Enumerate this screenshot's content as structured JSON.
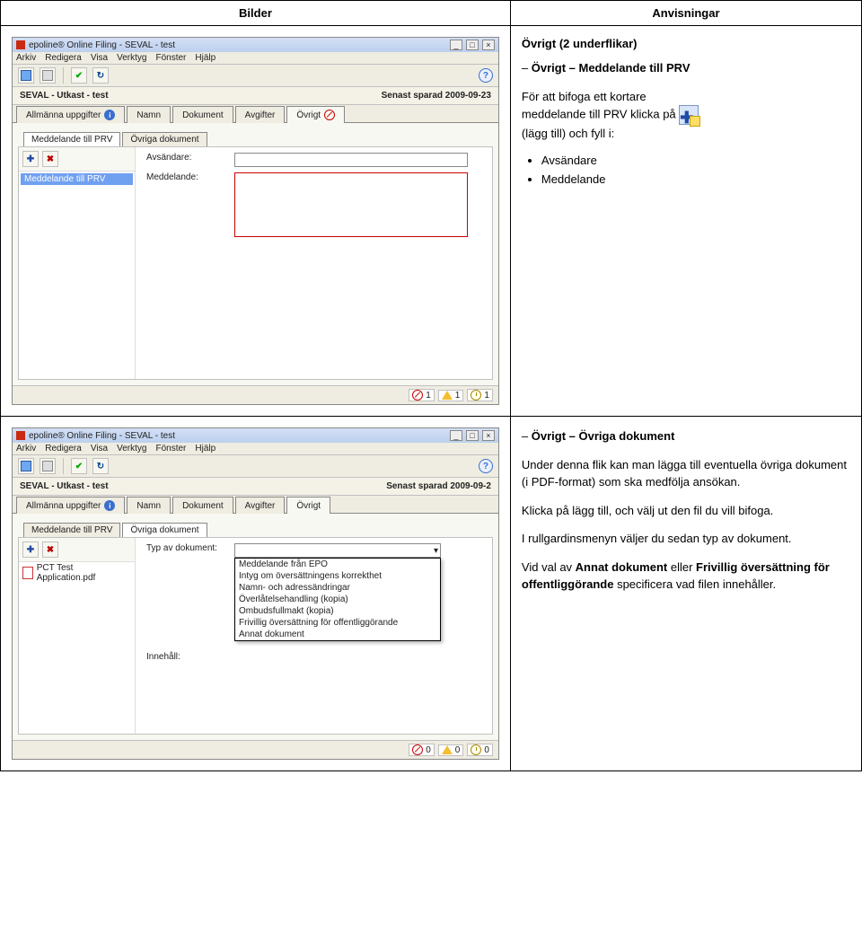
{
  "columns": {
    "left": "Bilder",
    "right": "Anvisningar"
  },
  "shared": {
    "app_title": "epoline® Online Filing - SEVAL - test",
    "menus": [
      "Arkiv",
      "Redigera",
      "Visa",
      "Verktyg",
      "Fönster",
      "Hjälp"
    ],
    "doc_title": "SEVAL - Utkast - test",
    "saved_label": "Senast sparad 2009-09-23",
    "tabs": {
      "allmanna": "Allmänna uppgifter",
      "namn": "Namn",
      "dokument": "Dokument",
      "avgifter": "Avgifter",
      "ovrigt": "Övrigt"
    },
    "status_counts": {
      "stop": "1",
      "warn": "1",
      "info": "1",
      "stop2": "0",
      "warn2": "0",
      "info2": "0"
    }
  },
  "win_top": {
    "subtabs": {
      "tab1": "Meddelande till PRV",
      "tab2": "Övriga dokument"
    },
    "left_item": "Meddelande till PRV",
    "form": {
      "avsandare": "Avsändare:",
      "meddelande": "Meddelande:"
    }
  },
  "win_bot": {
    "saved_label": "Senast sparad 2009-09-2",
    "subtabs": {
      "tab1": "Meddelande till PRV",
      "tab2": "Övriga dokument"
    },
    "file_item": "PCT Test Application.pdf",
    "form": {
      "typ": "Typ av dokument:",
      "innehall": "Innehåll:",
      "options": [
        "Meddelande från EPO",
        "Intyg om översättningens korrekthet",
        "Namn- och adressändringar",
        "Överlåtelsehandling (kopia)",
        "Ombudsfullmakt (kopia)",
        "Frivillig översättning för offentliggörande",
        "Annat dokument"
      ]
    }
  },
  "instr_top": {
    "heading": "Övrigt (2 underflikar)",
    "subtitle": "Övrigt – Meddelande till PRV",
    "p1a": "För att bifoga ett kortare",
    "p1b": "meddelande till PRV klicka på",
    "p1c": "(lägg till) och fyll i:",
    "bullets": [
      "Avsändare",
      "Meddelande"
    ]
  },
  "instr_bot": {
    "subtitle": "Övrigt – Övriga dokument",
    "p1": "Under denna flik kan man lägga till eventuella övriga dokument (i PDF-format) som ska medfölja ansökan.",
    "p2": "Klicka på lägg till, och välj ut den fil du vill bifoga.",
    "p3": "I rullgardinsmenyn väljer du sedan typ av dokument.",
    "p4a": "Vid val av ",
    "p4b": "Annat dokument",
    "p4c": " eller ",
    "p4d": "Frivillig översättning för offentliggörande",
    "p4e": " specificera vad filen innehåller."
  }
}
